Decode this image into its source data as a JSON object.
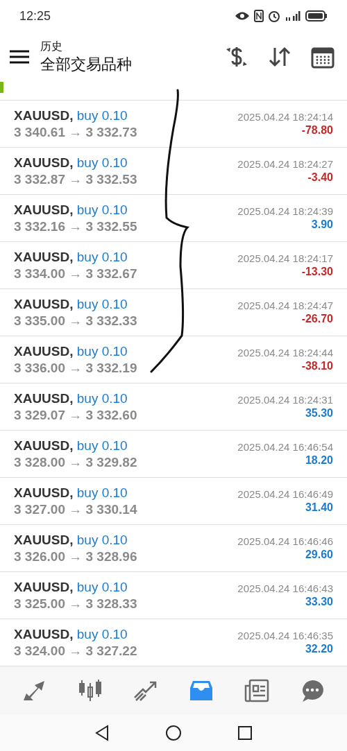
{
  "status_bar": {
    "time": "12:25"
  },
  "header": {
    "title": "历史",
    "subtitle": "全部交易品种"
  },
  "partial_row": {
    "color": "#7cb518"
  },
  "trades": [
    {
      "symbol": "XAUUSD,",
      "side": "buy 0.10",
      "prices": "3 340.61 → 3 332.73",
      "time": "2025.04.24 18:24:14",
      "profit": "-78.80",
      "color": "#c62828"
    },
    {
      "symbol": "XAUUSD,",
      "side": "buy 0.10",
      "prices": "3 332.87 → 3 332.53",
      "time": "2025.04.24 18:24:27",
      "profit": "-3.40",
      "color": "#c62828"
    },
    {
      "symbol": "XAUUSD,",
      "side": "buy 0.10",
      "prices": "3 332.16 → 3 332.55",
      "time": "2025.04.24 18:24:39",
      "profit": "3.90",
      "color": "#1a7bd1"
    },
    {
      "symbol": "XAUUSD,",
      "side": "buy 0.10",
      "prices": "3 334.00 → 3 332.67",
      "time": "2025.04.24 18:24:17",
      "profit": "-13.30",
      "color": "#c62828"
    },
    {
      "symbol": "XAUUSD,",
      "side": "buy 0.10",
      "prices": "3 335.00 → 3 332.33",
      "time": "2025.04.24 18:24:47",
      "profit": "-26.70",
      "color": "#c62828"
    },
    {
      "symbol": "XAUUSD,",
      "side": "buy 0.10",
      "prices": "3 336.00 → 3 332.19",
      "time": "2025.04.24 18:24:44",
      "profit": "-38.10",
      "color": "#c62828"
    },
    {
      "symbol": "XAUUSD,",
      "side": "buy 0.10",
      "prices": "3 329.07 → 3 332.60",
      "time": "2025.04.24 18:24:31",
      "profit": "35.30",
      "color": "#1a7bd1"
    },
    {
      "symbol": "XAUUSD,",
      "side": "buy 0.10",
      "prices": "3 328.00 → 3 329.82",
      "time": "2025.04.24 16:46:54",
      "profit": "18.20",
      "color": "#1a7bd1"
    },
    {
      "symbol": "XAUUSD,",
      "side": "buy 0.10",
      "prices": "3 327.00 → 3 330.14",
      "time": "2025.04.24 16:46:49",
      "profit": "31.40",
      "color": "#1a7bd1"
    },
    {
      "symbol": "XAUUSD,",
      "side": "buy 0.10",
      "prices": "3 326.00 → 3 328.96",
      "time": "2025.04.24 16:46:46",
      "profit": "29.60",
      "color": "#1a7bd1"
    },
    {
      "symbol": "XAUUSD,",
      "side": "buy 0.10",
      "prices": "3 325.00 → 3 328.33",
      "time": "2025.04.24 16:46:43",
      "profit": "33.30",
      "color": "#1a7bd1"
    },
    {
      "symbol": "XAUUSD,",
      "side": "buy 0.10",
      "prices": "3 324.00 → 3 327.22",
      "time": "2025.04.24 16:46:35",
      "profit": "32.20",
      "color": "#1a7bd1"
    }
  ],
  "bottom_tabs": [
    {
      "kind": "quotes",
      "selected": false
    },
    {
      "kind": "chart",
      "selected": false
    },
    {
      "kind": "trade",
      "selected": false
    },
    {
      "kind": "history",
      "selected": true
    },
    {
      "kind": "news",
      "selected": false
    },
    {
      "kind": "chat",
      "selected": false
    }
  ]
}
